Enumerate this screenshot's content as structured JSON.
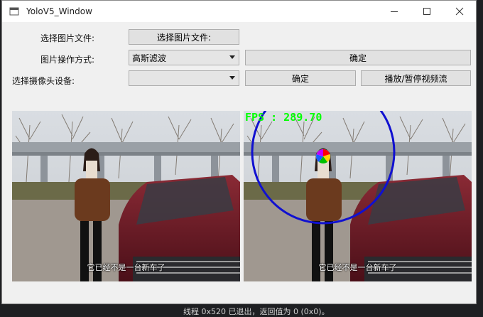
{
  "window": {
    "title": "YoloV5_Window"
  },
  "form": {
    "select_file_label": "选择图片文件:",
    "select_file_button": "选择图片文件:",
    "operation_label": "图片操作方式:",
    "operation_value": "高斯滤波",
    "operation_confirm": "确定",
    "camera_label": "选择摄像头设备:",
    "camera_value": "",
    "camera_confirm": "确定",
    "play_pause_button": "播放/暂停视频流"
  },
  "left_video": {
    "subtitle": "它已经不是一台新车了"
  },
  "right_video": {
    "subtitle": "它已经不是一台新车了",
    "fps": "FPS : 289.70"
  },
  "statusbar": {
    "text": "线程 0x520 已退出，返回值为 0 (0x0)。"
  }
}
